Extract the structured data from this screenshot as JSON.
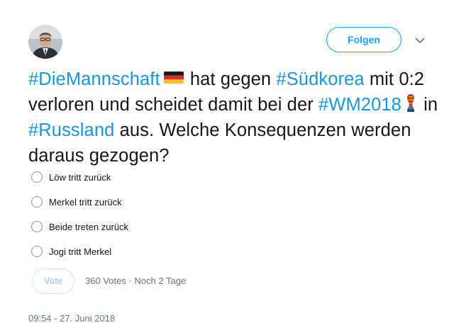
{
  "author": {
    "avatar_icon": "profile-photo"
  },
  "header": {
    "follow_label": "Folgen",
    "menu_icon": "chevron-down-icon"
  },
  "tweet": {
    "segments": [
      "#DieMannschaft",
      "hat gegen",
      "#Südkorea",
      "mit",
      "0:2 verloren und scheidet damit bei der",
      "#WM2018",
      "in",
      "#Russland",
      "aus. Welche",
      "Konsequenzen werden daraus gezogen?"
    ],
    "emoji": [
      "germany-flag-emoji",
      "world-cup-trophy-emoji"
    ]
  },
  "poll": {
    "options": [
      "Löw tritt zurück",
      "Merkel tritt zurück",
      "Beide treten zurück",
      "Jogi tritt Merkel"
    ],
    "vote_label": "Vote",
    "votes": "360 Votes",
    "separator": "·",
    "remaining": "Noch 2 Tage"
  },
  "timestamp": "09:54 - 27. Juni 2018",
  "colors": {
    "accent": "#1da1f2",
    "hashtag": "#1b95e0",
    "muted": "#657786",
    "vote_disabled": "#a9d4f3"
  }
}
